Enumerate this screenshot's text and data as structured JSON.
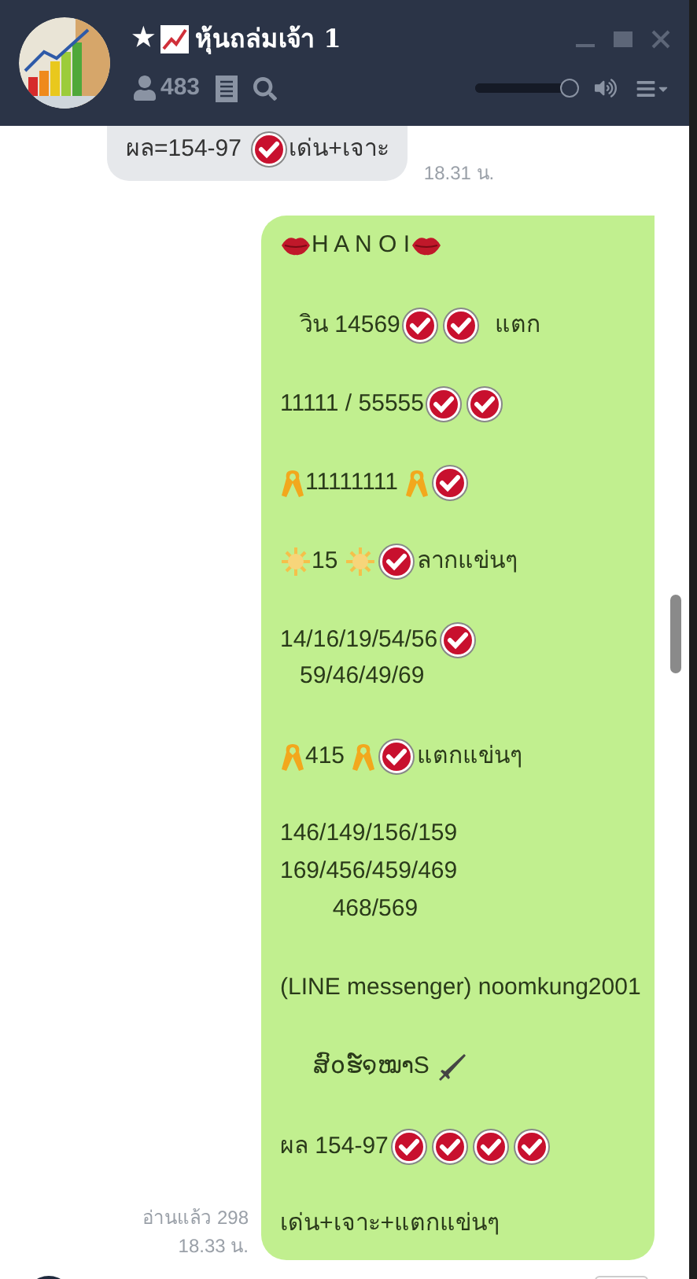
{
  "header": {
    "star": "★",
    "title": "หุ้นถล่มเจ้า 1",
    "member_count": "483",
    "volume": {
      "level": 0.93
    }
  },
  "previous_message": {
    "segments": [
      {
        "kind": "text",
        "text": "ผล=154-97 "
      },
      {
        "kind": "check"
      },
      {
        "kind": "text",
        "text": "เด่น+เจาะ"
      }
    ],
    "time": "18.31 น."
  },
  "message": {
    "read": "อ่านแล้ว 298",
    "time": "18.33 น.",
    "paragraphs": [
      [
        [
          {
            "kind": "lips"
          },
          {
            "kind": "text",
            "text": "H A N O I"
          },
          {
            "kind": "lips"
          }
        ]
      ],
      [
        [
          {
            "kind": "text",
            "text": "   วิน 14569"
          },
          {
            "kind": "check"
          },
          {
            "kind": "check"
          },
          {
            "kind": "text",
            "text": "  แตก"
          }
        ]
      ],
      [
        [
          {
            "kind": "text",
            "text": "11111 / 55555"
          },
          {
            "kind": "check"
          },
          {
            "kind": "check"
          }
        ]
      ],
      [
        [
          {
            "kind": "ribbon"
          },
          {
            "kind": "text",
            "text": "11111111 "
          },
          {
            "kind": "ribbon"
          },
          {
            "kind": "check"
          }
        ]
      ],
      [
        [
          {
            "kind": "sun"
          },
          {
            "kind": "text",
            "text": "15 "
          },
          {
            "kind": "sun"
          },
          {
            "kind": "check"
          },
          {
            "kind": "text",
            "text": "ลากแข่นๆ"
          }
        ]
      ],
      [
        [
          {
            "kind": "text",
            "text": "14/16/19/54/56"
          },
          {
            "kind": "check"
          }
        ],
        [
          {
            "kind": "text",
            "text": "   59/46/49/69"
          }
        ]
      ],
      [
        [
          {
            "kind": "ribbon"
          },
          {
            "kind": "text",
            "text": "415 "
          },
          {
            "kind": "ribbon"
          },
          {
            "kind": "check"
          },
          {
            "kind": "text",
            "text": "แตกแข่นๆ"
          }
        ]
      ],
      [
        [
          {
            "kind": "text",
            "text": "146/149/156/159"
          }
        ],
        [
          {
            "kind": "text",
            "text": "169/456/459/469"
          }
        ],
        [
          {
            "kind": "text",
            "text": "        468/569"
          }
        ]
      ],
      [
        [
          {
            "kind": "text",
            "text": "(LINE messenger) noomkung2001"
          }
        ]
      ],
      [
        [
          {
            "kind": "text",
            "text": "     ສົ໐ຮ໌໑ໝາS "
          },
          {
            "kind": "dagger"
          }
        ]
      ],
      [
        [
          {
            "kind": "text",
            "text": "ผล 154-97"
          },
          {
            "kind": "check"
          },
          {
            "kind": "check"
          },
          {
            "kind": "check"
          },
          {
            "kind": "check"
          }
        ]
      ],
      [
        [
          {
            "kind": "text",
            "text": "เด่น+เจาะ+แตกแข่นๆ"
          }
        ]
      ]
    ]
  }
}
